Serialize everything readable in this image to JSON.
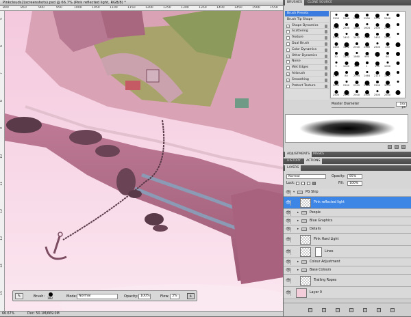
{
  "document": {
    "title": "Pinkclouds2(screenshots).psd @ 66.7% (Pink reflected light, RGB/8) *",
    "ruler_top_labels": [
      "800",
      "850",
      "900",
      "950",
      "1000",
      "1050",
      "1100",
      "1150",
      "1200",
      "1250",
      "1300",
      "1350",
      "1400",
      "1450",
      "1500",
      "1550"
    ],
    "ruler_left_labels": [
      "5",
      "6",
      "7",
      "8",
      "9",
      "10",
      "11",
      "12",
      "13",
      "14",
      "15"
    ]
  },
  "status": {
    "zoom": "66.67%",
    "doc_info": "Doc: 50.1M/669.0M"
  },
  "brush_toolbar": {
    "brush_label": "Brush:",
    "brush_size": "182",
    "mode_label": "Mode:",
    "mode_value": "Normal",
    "opacity_label": "Opacity:",
    "opacity_value": "100%",
    "flow_label": "Flow:",
    "flow_value": "3%"
  },
  "brushes_panel": {
    "tabs": [
      "BRUSHES",
      "CLONE SOURCE"
    ],
    "options": [
      {
        "label": "Brush Presets",
        "kind": "header"
      },
      {
        "label": "Brush Tip Shape",
        "kind": "plain"
      },
      {
        "label": "Shape Dynamics",
        "checked": true
      },
      {
        "label": "Scattering",
        "checked": false
      },
      {
        "label": "Texture",
        "checked": false
      },
      {
        "label": "Dual Brush",
        "checked": false
      },
      {
        "label": "Color Dynamics",
        "checked": false
      },
      {
        "label": "Other Dynamics",
        "checked": true
      },
      {
        "label": "Noise",
        "checked": false
      },
      {
        "label": "Wet Edges",
        "checked": false
      },
      {
        "label": "Airbrush",
        "checked": true
      },
      {
        "label": "Smoothing",
        "checked": true
      },
      {
        "label": "Protect Texture",
        "checked": false
      }
    ],
    "preset_sizes": [
      "2500",
      "2500",
      "2500",
      "2500",
      "2500",
      "2500",
      "",
      "2500",
      "2500",
      "1604",
      "1604",
      "2500",
      "2500",
      "",
      "2500",
      "1452",
      "1452",
      "1452",
      "1452",
      "2500",
      "",
      "1452",
      "1452",
      "2500",
      "2500",
      "2500",
      "150",
      "",
      "30",
      "1452",
      "1860",
      "995",
      "7",
      "60",
      "",
      "9",
      "1000",
      "455",
      "1",
      "195",
      "1000",
      "",
      "2317",
      "80",
      "2094",
      "1464",
      "2115",
      "1467",
      "",
      "1000",
      "2500",
      "2359",
      "2358",
      "2500",
      "3000",
      "",
      "2500",
      "2500",
      "2500",
      "2500",
      "2500",
      "2500",
      ""
    ],
    "master_diameter_label": "Master Diameter",
    "master_diameter_value": "182 px"
  },
  "adjust_tabs": [
    "ADJUSTMENTS",
    "MASKS"
  ],
  "history_tabs": [
    "HISTORY",
    "ACTIONS"
  ],
  "layers_panel": {
    "tab": "LAYERS",
    "blend_mode": "Normal",
    "opacity_label": "Opacity:",
    "opacity_value": "85%",
    "lock_label": "Lock:",
    "fill_label": "Fill:",
    "fill_value": "100%",
    "layers": [
      {
        "name": "PG Ship",
        "kind": "group-open",
        "indent": 0
      },
      {
        "name": "Pink reflected light",
        "kind": "layer",
        "indent": 1,
        "selected": true
      },
      {
        "name": "People",
        "kind": "group",
        "indent": 1
      },
      {
        "name": "Blue Graphics",
        "kind": "group",
        "indent": 1
      },
      {
        "name": "Details",
        "kind": "group",
        "indent": 1
      },
      {
        "name": "Pink Hard Light",
        "kind": "layer",
        "indent": 1
      },
      {
        "name": "Lines",
        "kind": "layer-mask",
        "indent": 1
      },
      {
        "name": "Colour Adjustment",
        "kind": "group",
        "indent": 1
      },
      {
        "name": "Base Colours",
        "kind": "group",
        "indent": 1
      },
      {
        "name": "Trailing Ropes",
        "kind": "layer",
        "indent": 1
      },
      {
        "name": "Layer 0",
        "kind": "layer-pink",
        "indent": 0
      }
    ]
  },
  "colors": {
    "selection": "#3d86e6",
    "panel_bg": "#d6d6d6",
    "tab_bar": "#4e4e4e"
  }
}
